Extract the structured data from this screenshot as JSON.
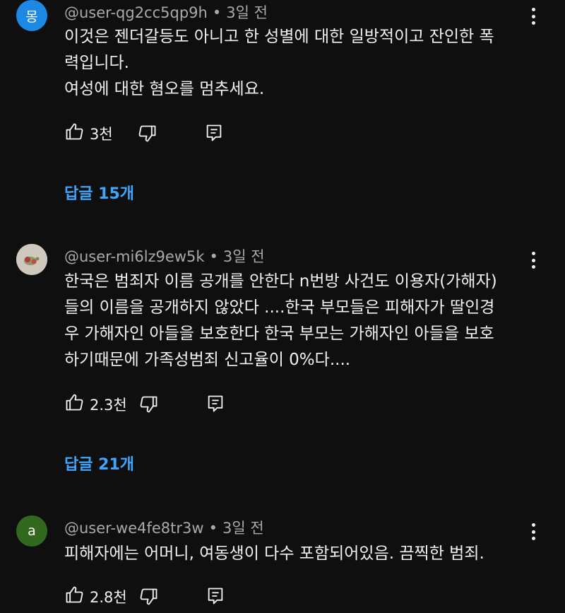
{
  "comments": [
    {
      "avatar_text": "몽",
      "avatar_color": "#1e88e5",
      "username": "@user-qg2cc5qp9h",
      "time": "3일 전",
      "lines": [
        "이것은 젠더갈등도 아니고 한 성별에 대한 일방적이고 잔인한 폭",
        "력입니다.",
        "여성에 대한 혐오를 멈추세요."
      ],
      "likes": "3천",
      "replies_label": "답글 15개"
    },
    {
      "avatar_text": "",
      "avatar_color": "#c9c4ba",
      "username": "@user-mi6lz9ew5k",
      "time": "3일 전",
      "lines": [
        "한국은 범죄자 이름 공개를 안한다 n번방 사건도 이용자(가해자)",
        "들의 이름을 공개하지 않았다 ....한국 부모들은 피해자가 딸인경",
        "우 가해자인 아들을 보호한다 한국 부모는 가해자인 아들을 보호",
        "하기때문에 가족성범죄 신고율이 0%다...."
      ],
      "likes": "2.3천",
      "replies_label": "답글 21개"
    },
    {
      "avatar_text": "a",
      "avatar_color": "#33691e",
      "username": "@user-we4fe8tr3w",
      "time": "3일 전",
      "lines": [
        "피해자에는 어머니, 여동생이 다수 포함되어있음. 끔찍한 범죄."
      ],
      "likes": "2.8천"
    }
  ],
  "separator": "•",
  "icons": {
    "like": "thumbs-up-icon",
    "dislike": "thumbs-down-icon",
    "reply": "reply-comment-icon",
    "more": "more-vertical-icon"
  },
  "colors": {
    "background": "#0f0f0f",
    "text": "#f1f1f1",
    "meta": "#aaaaaa",
    "link": "#3ea6ff"
  }
}
